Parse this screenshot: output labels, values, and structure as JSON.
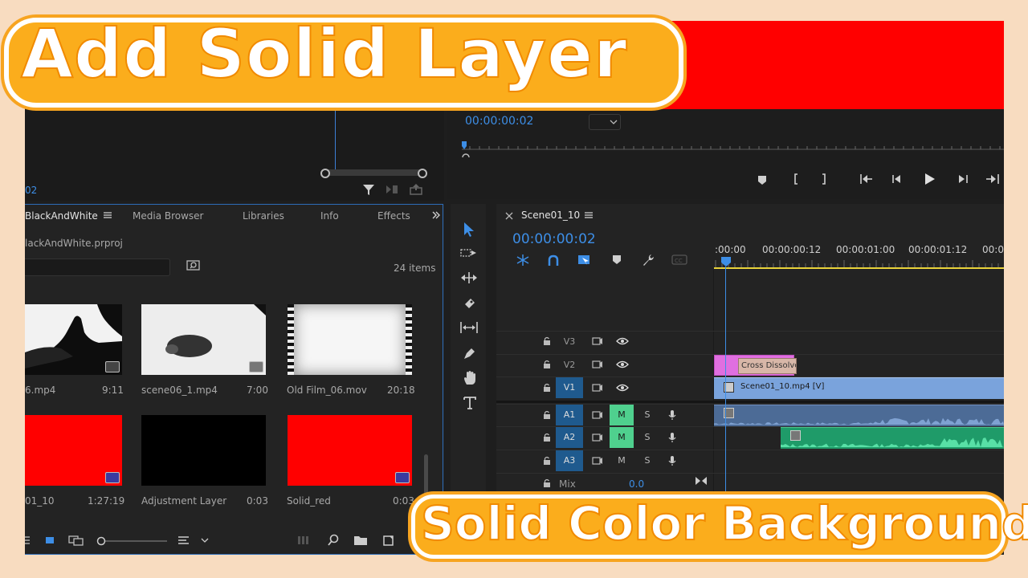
{
  "overlay": {
    "title": "Add Solid Layer",
    "subtitle": "Solid Color Background"
  },
  "program_monitor": {
    "timecode": "00:00:00:02",
    "preview_color": "#ff0000"
  },
  "source_monitor": {
    "timecode_partial": "02"
  },
  "project_panel": {
    "tabs": [
      "BlackAndWhite",
      "Media Browser",
      "Libraries",
      "Info",
      "Effects"
    ],
    "project_file": "lackAndWhite.prproj",
    "item_count": "24 items",
    "items": [
      {
        "name": "6.mp4",
        "duration": "9:11",
        "kind": "bw-tree"
      },
      {
        "name": "scene06_1.mp4",
        "duration": "7:00",
        "kind": "bw-animal"
      },
      {
        "name": "Old Film_06.mov",
        "duration": "20:18",
        "kind": "oldfilm"
      },
      {
        "name": "01_10",
        "duration": "1:27:19",
        "kind": "red"
      },
      {
        "name": "Adjustment Layer",
        "duration": "0:03",
        "kind": "black"
      },
      {
        "name": "Solid_red",
        "duration": "0:03",
        "kind": "red"
      }
    ]
  },
  "timeline": {
    "sequence_name": "Scene01_10",
    "timecode": "00:00:00:02",
    "ruler_labels": [
      ":00:00",
      "00:00:00:12",
      "00:00:01:00",
      "00:00:01:12",
      "00:0"
    ],
    "video_tracks": [
      "V3",
      "V2",
      "V1"
    ],
    "audio_tracks": [
      "A1",
      "A2",
      "A3"
    ],
    "mute_label": "M",
    "solo_label": "S",
    "mix_label": "Mix",
    "mix_value": "0.0",
    "clips": {
      "transition": "Cross Dissolve",
      "v1_clip": "Scene01_10.mp4 [V]"
    }
  }
}
